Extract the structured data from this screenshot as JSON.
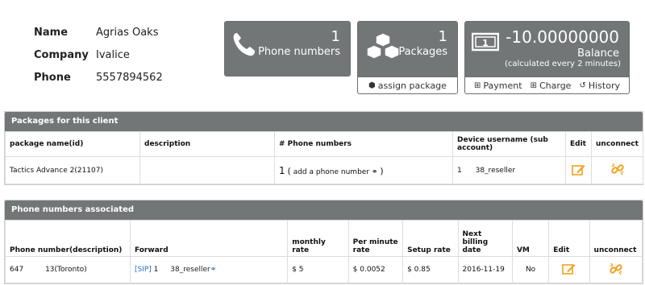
{
  "client": {
    "name_label": "Name",
    "name_value": "Agrias Oaks",
    "company_label": "Company",
    "company_value": "Ivalice",
    "phone_label": "Phone",
    "phone_value": "5557894562"
  },
  "stats": {
    "phones": {
      "count": "1",
      "label": "Phone numbers",
      "icon": "phone-icon"
    },
    "packages": {
      "count": "1",
      "label": "Packages",
      "icon": "cubes-icon",
      "assign_label": "assign package"
    },
    "balance": {
      "value": "-10.00000000",
      "label": "Balance",
      "sub": "(calculated every 2 minutes)",
      "icon": "money-icon",
      "payment_label": "Payment",
      "charge_label": "Charge",
      "history_label": "History"
    }
  },
  "packages_table": {
    "title": "Packages for this client",
    "headers": {
      "name": "package name(id)",
      "description": "description",
      "phones": "# Phone numbers",
      "device": "Device username (sub account)",
      "edit": "Edit",
      "unconnect": "unconnect"
    },
    "row": {
      "name": "Tactics Advance 2(21107)",
      "description": "",
      "phones_count": "1",
      "open_paren": "(",
      "add_label": "add a phone number",
      "close_paren": ")",
      "device_id": "1",
      "device_user": "38_reseller"
    }
  },
  "phones_table": {
    "title": "Phone numbers associated",
    "headers": {
      "number": "Phone number(description)",
      "forward": "Forward",
      "monthly": "monthly rate",
      "per_minute": "Per minute rate",
      "setup": "Setup rate",
      "next_billing": "Next billing date",
      "vm": "VM",
      "edit": "Edit",
      "unconnect": "unconnect"
    },
    "row": {
      "number": "647",
      "description": "13(Toronto)",
      "forward_type": "[SIP]",
      "forward_id": "1",
      "forward_user": "38_reseller",
      "monthly": "$ 5",
      "per_minute": "$ 0.0052",
      "setup": "$ 0.85",
      "next_billing": "2016-11-19",
      "vm": "No"
    }
  },
  "colors": {
    "panel": "#737677",
    "link": "#2b6fb5",
    "edit_icon": "#f0a21d",
    "unconnect_icon": "#f0a21d"
  }
}
